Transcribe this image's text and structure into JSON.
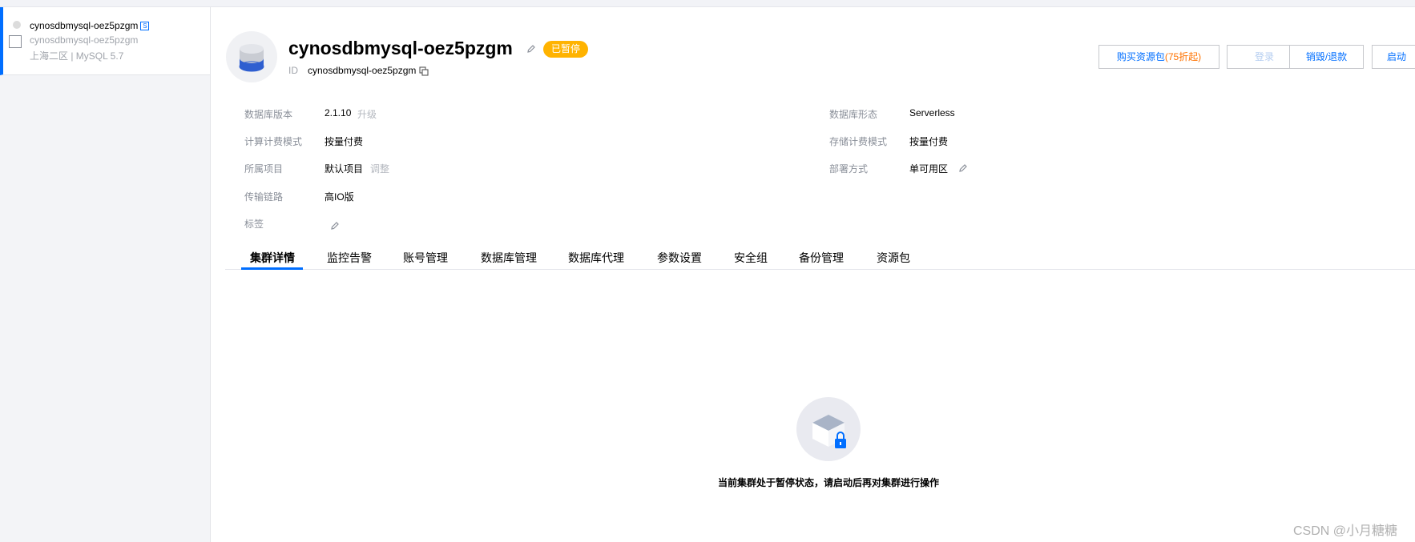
{
  "sidebar": {
    "instance_name": "cynosdbmysql-oez5pzgm",
    "instance_badge": "S",
    "instance_sub": "cynosdbmysql-oez5pzgm",
    "instance_region": "上海二区 | MySQL 5.7"
  },
  "header": {
    "title": "cynosdbmysql-oez5pzgm",
    "status": "已暂停",
    "id_label": "ID",
    "id_value": "cynosdbmysql-oez5pzgm",
    "buttons": {
      "buy_package": "购买资源包",
      "buy_package_discount": "(75折起)",
      "login": "登录",
      "destroy_refund": "销毁/退款",
      "start": "启动"
    }
  },
  "info": {
    "db_version_label": "数据库版本",
    "db_version_value": "2.1.10",
    "db_version_link": "升级",
    "db_form_label": "数据库形态",
    "db_form_value": "Serverless",
    "compute_billing_label": "计算计费模式",
    "compute_billing_value": "按量付费",
    "storage_billing_label": "存储计费模式",
    "storage_billing_value": "按量付费",
    "project_label": "所属项目",
    "project_value": "默认项目",
    "project_link": "调整",
    "deploy_label": "部署方式",
    "deploy_value": "单可用区",
    "transport_label": "传输链路",
    "transport_value": "高IO版",
    "tag_label": "标签"
  },
  "tabs": [
    {
      "label": "集群详情",
      "active": true
    },
    {
      "label": "监控告警"
    },
    {
      "label": "账号管理"
    },
    {
      "label": "数据库管理"
    },
    {
      "label": "数据库代理"
    },
    {
      "label": "参数设置"
    },
    {
      "label": "安全组"
    },
    {
      "label": "备份管理"
    },
    {
      "label": "资源包"
    }
  ],
  "empty_state": {
    "message": "当前集群处于暂停状态，请启动后再对集群进行操作"
  },
  "watermark": "CSDN @小月糖糖",
  "colors": {
    "accent": "#006eff",
    "status_badge": "#ffb300",
    "discount": "#ff7200"
  }
}
